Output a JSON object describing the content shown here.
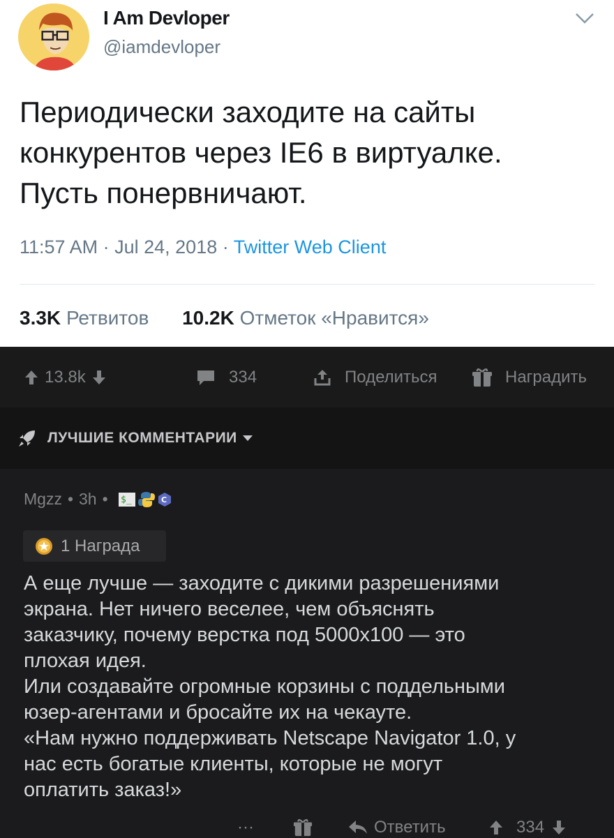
{
  "tweet": {
    "author_name": "I Am Devloper",
    "author_handle": "@iamdevloper",
    "text_lines": [
      "Периодически заходите на сайты",
      "конкурентов через IE6 в виртуалке.",
      "Пусть понервничают."
    ],
    "time": "11:57 AM",
    "date": "Jul 24, 2018",
    "separator": "·",
    "client": "Twitter Web Client",
    "retweets_count": "3.3K",
    "retweets_label": "Ретвитов",
    "likes_count": "10.2K",
    "likes_label": "Отметок «Нравится»",
    "icons": {
      "avatar": "avatar-image",
      "menu": "chevron-down-icon"
    },
    "colors": {
      "link": "#1b95e0",
      "muted": "#657786"
    }
  },
  "post_bar": {
    "score": "13.8k",
    "comments": "334",
    "share_label": "Поделиться",
    "award_label": "Наградить"
  },
  "comments_sort": {
    "label": "ЛУЧШИЕ КОММЕНТАРИИ"
  },
  "comment": {
    "author": "Mgzz",
    "dot": "•",
    "age": "3h",
    "award_text": "1 Награда",
    "body_lines": [
      "А еще лучше — заходите с дикими разрешениями",
      "экрана. Нет ничего веселее, чем объяснять",
      "заказчику, почему верстка под 5000x100 — это",
      "плохая идея.",
      "Или создавайте огромные корзины с поддельными",
      "юзер-агентами  и бросайте их на чекауте.",
      "«Нам нужно поддерживать Netscape Navigator 1.0, у",
      "нас есть богатые клиенты, которые не могут",
      "оплатить заказ!»"
    ],
    "more": "···",
    "reply_label": "Ответить",
    "score": "334"
  }
}
